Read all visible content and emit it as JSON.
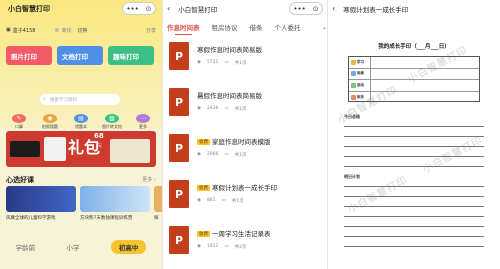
{
  "panel1": {
    "title": "小白智慧打印",
    "capsule_more": "•••",
    "capsule_close": "⊙",
    "device": {
      "name": "盒子4158",
      "status": "离线",
      "switch": "切换",
      "share": "分享"
    },
    "actions": [
      {
        "label": "照片打印",
        "color": "#f25a68"
      },
      {
        "label": "文档打印",
        "color": "#4f8fe8"
      },
      {
        "label": "趣味打印",
        "color": "#3cbf86"
      }
    ],
    "search_placeholder": "搜索学习资料",
    "grid": [
      {
        "label": "口算",
        "color": "#f26a5a",
        "icon": "calc-icon"
      },
      {
        "label": "拍照搜题",
        "color": "#f0a33a",
        "icon": "camera-icon"
      },
      {
        "label": "错题本",
        "color": "#4f8fe8",
        "icon": "notebook-icon"
      },
      {
        "label": "图片转文档",
        "color": "#3cbf86",
        "icon": "image-doc-icon"
      },
      {
        "label": "更多",
        "color": "#b07ad8",
        "icon": "more-icon"
      }
    ],
    "banner": {
      "big": "礼包",
      "num": "68",
      "sub": "元"
    },
    "section_title": "心选好课",
    "more": "更多 ›",
    "courses": [
      "风靡全球的儿童科学游戏",
      "方块熊7天数独课程训练营",
      "探"
    ],
    "tabs": [
      "学龄前",
      "小学",
      "初高中"
    ],
    "active_tab": 2
  },
  "panel2": {
    "title": "小白智慧打印",
    "capsule_more": "•••",
    "capsule_close": "⊙",
    "tabs": [
      "作息时间表",
      "租房协议",
      "借条",
      "个人委托"
    ],
    "active_tab": 0,
    "docs": [
      {
        "name": "寒假作息时间表简易版",
        "tag": "",
        "views": "5711",
        "pages": "共1页"
      },
      {
        "name": "暑假作息时间表简易版",
        "tag": "",
        "views": "2436",
        "pages": "共1页"
      },
      {
        "name": "家庭作息时间表模版",
        "tag": "收费",
        "views": "2066",
        "pages": "共1页"
      },
      {
        "name": "寒假计划表一成长手印",
        "tag": "收费",
        "views": "861",
        "pages": "共1页"
      },
      {
        "name": "一周学习生活记录表",
        "tag": "收费",
        "views": "1912",
        "pages": "共2页"
      }
    ],
    "view_icon": "eye-icon",
    "page_icon": "file-icon"
  },
  "panel3": {
    "title": "寒假计划表一成长手印",
    "sheet_title": "我的成长手印（___月___日）",
    "rows": [
      "学习",
      "阅读",
      "运动",
      "家务"
    ],
    "watermark": "小白智慧打印",
    "line_labels": [
      "今日总结",
      "明日计划"
    ]
  }
}
